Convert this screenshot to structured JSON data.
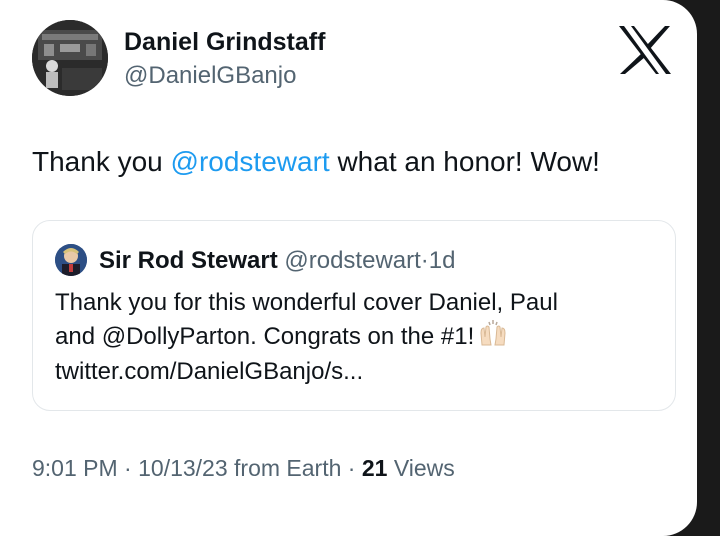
{
  "tweet": {
    "author": {
      "display_name": "Daniel Grindstaff",
      "handle": "@DanielGBanjo",
      "avatar_icon": "photo-avatar"
    },
    "brand_icon": "x-logo-icon",
    "text": {
      "before": "Thank you ",
      "mention": "@rodstewart",
      "after": " what an honor! Wow!"
    },
    "quoted": {
      "display_name": "Sir Rod Stewart",
      "handle": "@rodstewart",
      "separator": "·",
      "time": "1d",
      "lines": [
        "Thank you for this wonderful cover Daniel, Paul",
        "and @DollyParton. Congrats on the #1!",
        "twitter.com/DanielGBanjo/s..."
      ],
      "emoji": "raising-hands-emoji"
    },
    "meta": {
      "time": "9:01 PM",
      "sep1": " · ",
      "date": "10/13/23",
      "source": " from Earth",
      "sep2": " · ",
      "views_count": "21",
      "views_label": " Views"
    }
  },
  "colors": {
    "link": "#1d9bf0",
    "secondary_text": "#536471",
    "primary_text": "#0f1419"
  }
}
